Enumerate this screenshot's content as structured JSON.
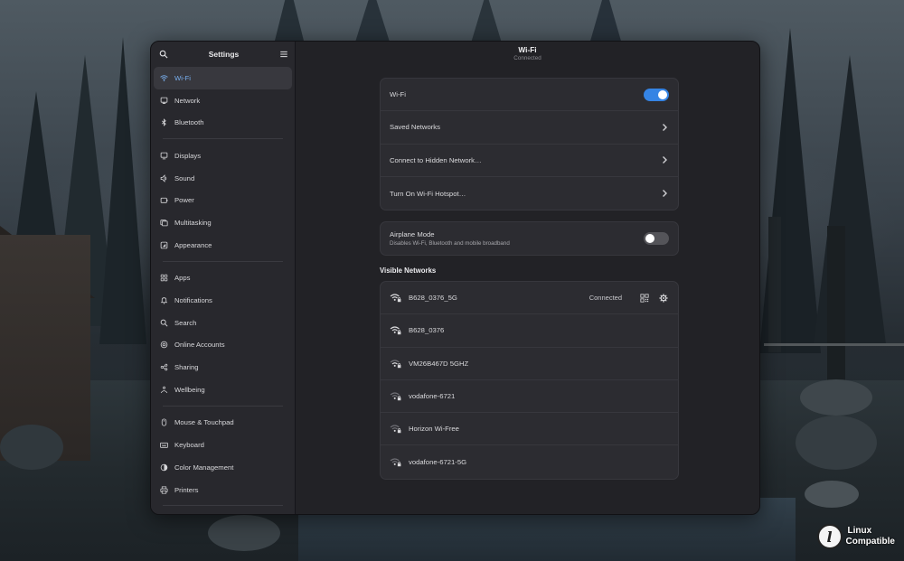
{
  "sidebar": {
    "title": "Settings",
    "items": [
      {
        "label": "Wi-Fi",
        "icon": "wifi-icon",
        "active": true
      },
      {
        "label": "Network",
        "icon": "network-icon"
      },
      {
        "label": "Bluetooth",
        "icon": "bluetooth-icon"
      },
      {
        "label": "Displays",
        "icon": "display-icon"
      },
      {
        "label": "Sound",
        "icon": "speaker-icon"
      },
      {
        "label": "Power",
        "icon": "power-icon"
      },
      {
        "label": "Multitasking",
        "icon": "multitasking-icon"
      },
      {
        "label": "Appearance",
        "icon": "appearance-icon"
      },
      {
        "label": "Apps",
        "icon": "apps-grid-icon"
      },
      {
        "label": "Notifications",
        "icon": "bell-icon"
      },
      {
        "label": "Search",
        "icon": "search-icon"
      },
      {
        "label": "Online Accounts",
        "icon": "at-sign-icon"
      },
      {
        "label": "Sharing",
        "icon": "share-icon"
      },
      {
        "label": "Wellbeing",
        "icon": "wellbeing-icon"
      },
      {
        "label": "Mouse & Touchpad",
        "icon": "mouse-icon"
      },
      {
        "label": "Keyboard",
        "icon": "keyboard-icon"
      },
      {
        "label": "Color Management",
        "icon": "color-icon"
      },
      {
        "label": "Printers",
        "icon": "printer-icon"
      }
    ]
  },
  "header": {
    "title": "Wi-Fi",
    "subtitle": "Connected"
  },
  "wifi_group": {
    "wifi_label": "Wi-Fi",
    "wifi_enabled": true,
    "saved_networks": "Saved Networks",
    "hidden_network": "Connect to Hidden Network…",
    "hotspot": "Turn On Wi-Fi Hotspot…"
  },
  "airplane": {
    "label": "Airplane Mode",
    "description": "Disables Wi-Fi, Bluetooth and mobile broadband",
    "enabled": false
  },
  "visible_networks": {
    "heading": "Visible Networks",
    "connected_label": "Connected",
    "networks": [
      {
        "ssid": "B628_0376_5G",
        "signal": "excellent",
        "secured": true
      },
      {
        "ssid": "B628_0376",
        "signal": "excellent",
        "secured": true
      },
      {
        "ssid": "VM26B467D 5GHZ",
        "signal": "good",
        "secured": true
      },
      {
        "ssid": "vodafone-6721",
        "signal": "weak",
        "secured": true
      },
      {
        "ssid": "Horizon Wi-Free",
        "signal": "weak",
        "secured": true
      },
      {
        "ssid": "vodafone-6721-5G",
        "signal": "weak",
        "secured": true
      }
    ]
  },
  "colors": {
    "accent": "#3584e4",
    "active_text": "#78aeed"
  },
  "watermark": {
    "line1": "Linux",
    "line2": "Compatible"
  }
}
